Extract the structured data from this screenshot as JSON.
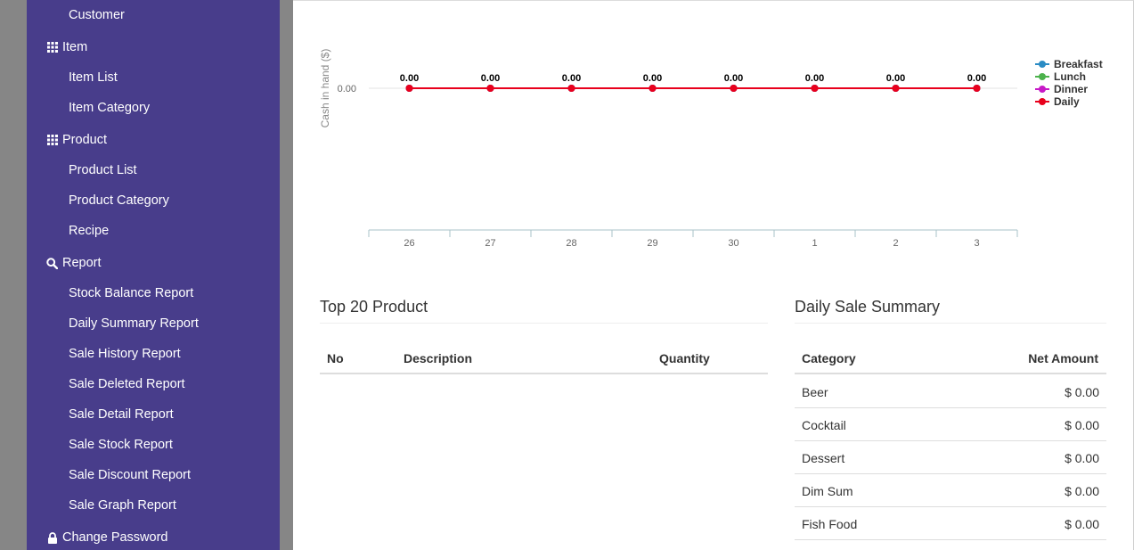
{
  "sidebar": {
    "items": [
      {
        "label": "Customer",
        "type": "sub"
      },
      {
        "label": "Item",
        "type": "section",
        "icon": "grid-icon"
      },
      {
        "label": "Item List",
        "type": "sub"
      },
      {
        "label": "Item Category",
        "type": "sub"
      },
      {
        "label": "Product",
        "type": "section",
        "icon": "grid-icon"
      },
      {
        "label": "Product List",
        "type": "sub"
      },
      {
        "label": "Product Category",
        "type": "sub"
      },
      {
        "label": "Recipe",
        "type": "sub"
      },
      {
        "label": "Report",
        "type": "section",
        "icon": "search-icon"
      },
      {
        "label": "Stock Balance Report",
        "type": "sub"
      },
      {
        "label": "Daily Summary Report",
        "type": "sub"
      },
      {
        "label": "Sale History Report",
        "type": "sub"
      },
      {
        "label": "Sale Deleted Report",
        "type": "sub"
      },
      {
        "label": "Sale Detail Report",
        "type": "sub"
      },
      {
        "label": "Sale Stock Report",
        "type": "sub"
      },
      {
        "label": "Sale Discount Report",
        "type": "sub"
      },
      {
        "label": "Sale Graph Report",
        "type": "sub"
      },
      {
        "label": "Change Password",
        "type": "section",
        "icon": "lock-icon"
      }
    ]
  },
  "colors": {
    "sidebar_bg": "#483d8b",
    "gutter": "#868686",
    "breakfast": "#2b8cc4",
    "lunch": "#4cb24c",
    "dinner": "#c71ac7",
    "daily": "#e8001c"
  },
  "chart_data": {
    "type": "line",
    "ylabel": "Cash in hand ($)",
    "yticks": [
      "0.00"
    ],
    "categories": [
      "26",
      "27",
      "28",
      "29",
      "30",
      "1",
      "2",
      "3"
    ],
    "series": [
      {
        "name": "Breakfast",
        "values": [
          0,
          0,
          0,
          0,
          0,
          0,
          0,
          0
        ]
      },
      {
        "name": "Lunch",
        "values": [
          0,
          0,
          0,
          0,
          0,
          0,
          0,
          0
        ]
      },
      {
        "name": "Dinner",
        "values": [
          0,
          0,
          0,
          0,
          0,
          0,
          0,
          0
        ]
      },
      {
        "name": "Daily",
        "values": [
          0,
          0,
          0,
          0,
          0,
          0,
          0,
          0
        ]
      }
    ],
    "data_labels": [
      "0.00",
      "0.00",
      "0.00",
      "0.00",
      "0.00",
      "0.00",
      "0.00",
      "0.00"
    ],
    "legend_position": "top-right"
  },
  "top_products": {
    "title": "Top 20 Product",
    "columns": [
      "No",
      "Description",
      "Quantity"
    ],
    "rows": []
  },
  "daily_summary": {
    "title": "Daily Sale Summary",
    "columns": [
      "Category",
      "Net Amount"
    ],
    "rows": [
      {
        "category": "Beer",
        "amount": "$ 0.00"
      },
      {
        "category": "Cocktail",
        "amount": "$ 0.00"
      },
      {
        "category": "Dessert",
        "amount": "$ 0.00"
      },
      {
        "category": "Dim Sum",
        "amount": "$ 0.00"
      },
      {
        "category": "Fish Food",
        "amount": "$ 0.00"
      }
    ]
  }
}
